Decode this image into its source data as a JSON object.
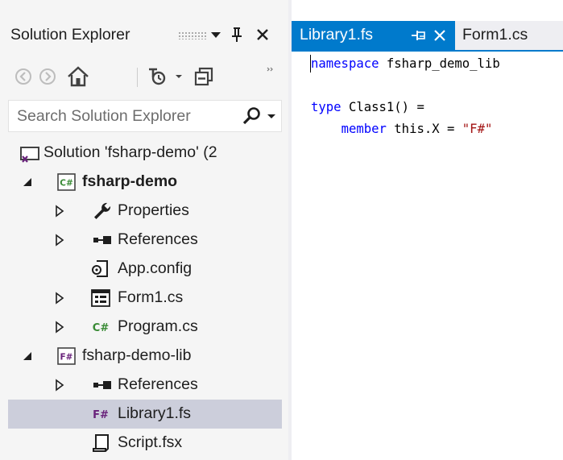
{
  "solution_explorer": {
    "title": "Solution Explorer",
    "title_buttons": {
      "dropdown": "window-position-dropdown",
      "pin": "pin-icon",
      "close": "close-icon"
    },
    "toolbar": {
      "items": [
        "back-arrow-icon",
        "forward-arrow-icon",
        "home-icon",
        "pending-changes-icon",
        "dropdown-arrow-icon",
        "collapse-all-icon",
        "overflow-icon"
      ]
    },
    "search": {
      "placeholder": "Search Solution Explorer",
      "value": ""
    },
    "tree": [
      {
        "label": "Solution 'fsharp-demo' (2",
        "icon": "solution-icon",
        "expander": "none",
        "bold": false,
        "selected": false,
        "level": 0
      },
      {
        "label": "fsharp-demo",
        "icon": "csharp-project-icon",
        "expander": "expanded",
        "bold": true,
        "selected": false,
        "level": 1
      },
      {
        "label": "Properties",
        "icon": "wrench-icon",
        "expander": "collapsed",
        "bold": false,
        "selected": false,
        "level": 2
      },
      {
        "label": "References",
        "icon": "references-icon",
        "expander": "collapsed",
        "bold": false,
        "selected": false,
        "level": 2
      },
      {
        "label": "App.config",
        "icon": "config-file-icon",
        "expander": "none",
        "bold": false,
        "selected": false,
        "level": 2
      },
      {
        "label": "Form1.cs",
        "icon": "form-icon",
        "expander": "collapsed",
        "bold": false,
        "selected": false,
        "level": 2
      },
      {
        "label": "Program.cs",
        "icon": "csharp-file-icon",
        "expander": "collapsed",
        "bold": false,
        "selected": false,
        "level": 2
      },
      {
        "label": "fsharp-demo-lib",
        "icon": "fsharp-project-icon",
        "expander": "expanded",
        "bold": false,
        "selected": false,
        "level": 1
      },
      {
        "label": "References",
        "icon": "references-icon",
        "expander": "collapsed",
        "bold": false,
        "selected": false,
        "level": 2
      },
      {
        "label": "Library1.fs",
        "icon": "fsharp-file-icon",
        "expander": "none",
        "bold": false,
        "selected": true,
        "level": 2
      },
      {
        "label": "Script.fsx",
        "icon": "script-file-icon",
        "expander": "none",
        "bold": false,
        "selected": false,
        "level": 2
      }
    ]
  },
  "editor": {
    "tabs": [
      {
        "label": "Library1.fs",
        "active": true,
        "pinned": true
      },
      {
        "label": "Form1.cs",
        "active": false,
        "pinned": false
      }
    ],
    "code": {
      "line1_keyword": "namespace",
      "line1_name": " fsharp_demo_lib",
      "line3_keyword": "type",
      "line3_rest": " Class1() =",
      "line4_indent": "    ",
      "line4_keyword": "member",
      "line4_mid": " this.X = ",
      "line4_string": "\"F#\""
    }
  },
  "colors": {
    "accent": "#007acc",
    "selection": "#cccedb",
    "panel_bg": "#f5f5f5",
    "keyword": "#0000ff",
    "string": "#a31515",
    "csharp_green": "#388a34",
    "fsharp_purple": "#68217a"
  }
}
